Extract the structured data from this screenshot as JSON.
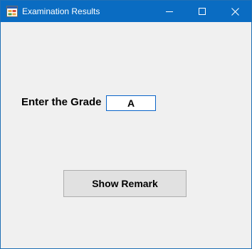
{
  "window": {
    "title": "Examination Results",
    "icon": "form-icon",
    "controls": {
      "minimize_icon": "minimize-icon",
      "maximize_icon": "maximize-icon",
      "close_icon": "close-icon"
    }
  },
  "form": {
    "grade_label": "Enter the Grade",
    "grade_value": "A",
    "show_remark_label": "Show Remark"
  },
  "colors": {
    "titlebar": "#0a6cc2",
    "client_background": "#f0f0f0",
    "input_border": "#0a64c8",
    "button_background": "#e1e1e1",
    "button_border": "#adadad"
  }
}
